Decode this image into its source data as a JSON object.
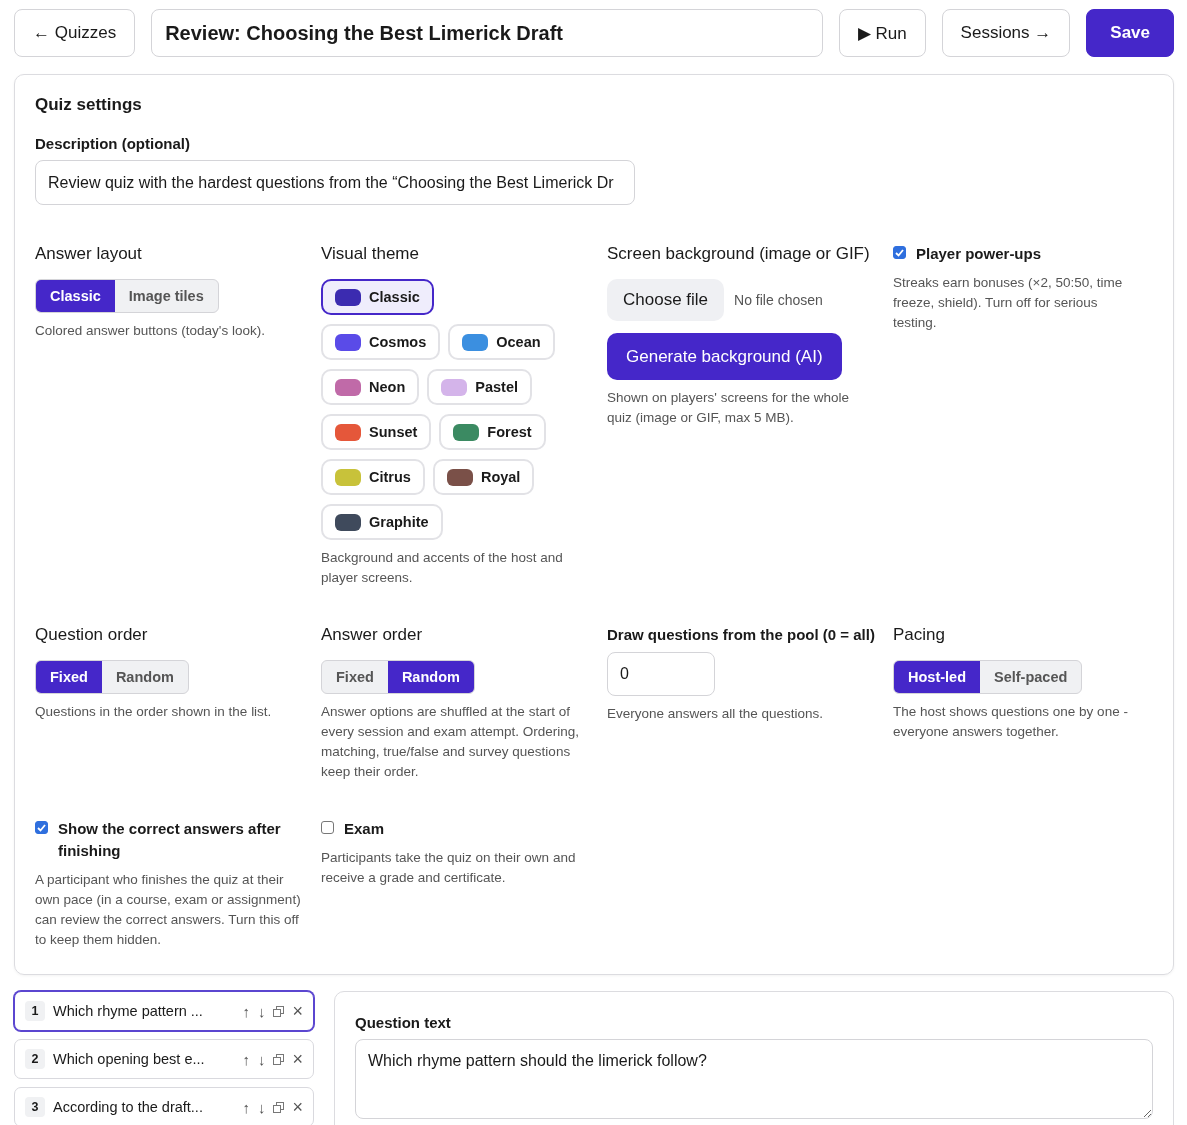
{
  "topbar": {
    "back": "← Quizzes",
    "title": "Review: Choosing the Best Limerick Draft",
    "run": "▶ Run",
    "sessions": "Sessions →",
    "save": "Save"
  },
  "settings": {
    "heading": "Quiz settings",
    "description_label": "Description (optional)",
    "description_value": "Review quiz with the hardest questions from the “Choosing the Best Limerick Dr",
    "answer_layout": {
      "label": "Answer layout",
      "options": [
        {
          "label": "Classic",
          "selected": true
        },
        {
          "label": "Image tiles",
          "selected": false
        }
      ],
      "hint": "Colored answer buttons (today's look)."
    },
    "visual_theme": {
      "label": "Visual theme",
      "themes": [
        {
          "label": "Classic",
          "color": "#3b2bb0",
          "selected": true
        },
        {
          "label": "Cosmos",
          "color": "#5a4be8",
          "selected": false
        },
        {
          "label": "Ocean",
          "color": "#3b8fe0",
          "selected": false
        },
        {
          "label": "Neon",
          "color": "#c06aa8",
          "selected": false
        },
        {
          "label": "Pastel",
          "color": "#d4b4ea",
          "selected": false
        },
        {
          "label": "Sunset",
          "color": "#e5573a",
          "selected": false
        },
        {
          "label": "Forest",
          "color": "#3b8a62",
          "selected": false
        },
        {
          "label": "Citrus",
          "color": "#c8c23a",
          "selected": false
        },
        {
          "label": "Royal",
          "color": "#7a5048",
          "selected": false
        },
        {
          "label": "Graphite",
          "color": "#3f4a5c",
          "selected": false
        }
      ],
      "hint": "Background and accents of the host and player screens."
    },
    "screen_background": {
      "label": "Screen background (image or GIF)",
      "choose": "Choose file",
      "no_file": "No file chosen",
      "generate": "Generate background (AI)",
      "hint": "Shown on players' screens for the whole quiz (image or GIF, max 5 MB)."
    },
    "power_ups": {
      "label": "Player power-ups",
      "checked": true,
      "hint": "Streaks earn bonuses (×2, 50:50, time freeze, shield). Turn off for serious testing."
    },
    "question_order": {
      "label": "Question order",
      "options": [
        {
          "label": "Fixed",
          "selected": true
        },
        {
          "label": "Random",
          "selected": false
        }
      ],
      "hint": "Questions in the order shown in the list."
    },
    "answer_order": {
      "label": "Answer order",
      "options": [
        {
          "label": "Fixed",
          "selected": false
        },
        {
          "label": "Random",
          "selected": true
        }
      ],
      "hint": "Answer options are shuffled at the start of every session and exam attempt. Ordering, matching, true/false and survey questions keep their order."
    },
    "pool": {
      "label": "Draw questions from the pool (0 = all)",
      "value": "0",
      "hint": "Everyone answers all the questions."
    },
    "pacing": {
      "label": "Pacing",
      "options": [
        {
          "label": "Host-led",
          "selected": true
        },
        {
          "label": "Self-paced",
          "selected": false
        }
      ],
      "hint": "The host shows questions one by one - everyone answers together."
    },
    "show_answers": {
      "label": "Show the correct answers after finishing",
      "checked": true,
      "hint": "A participant who finishes the quiz at their own pace (in a course, exam or assignment) can review the correct answers. Turn this off to keep them hidden."
    },
    "exam": {
      "label": "Exam",
      "checked": false,
      "hint": "Participants take the quiz on their own and receive a grade and certificate."
    }
  },
  "questions": [
    {
      "number": "1",
      "text": "Which rhyme pattern ...",
      "up": "↑",
      "down": "↓",
      "remove": "×",
      "selected": true
    },
    {
      "number": "2",
      "text": "Which opening best e...",
      "up": "↑",
      "down": "↓",
      "remove": "×",
      "selected": false
    },
    {
      "number": "3",
      "text": "According to the draft...",
      "up": "↑",
      "down": "↓",
      "remove": "×",
      "selected": false
    }
  ],
  "editor": {
    "label": "Question text",
    "value": "Which rhyme pattern should the limerick follow?"
  }
}
